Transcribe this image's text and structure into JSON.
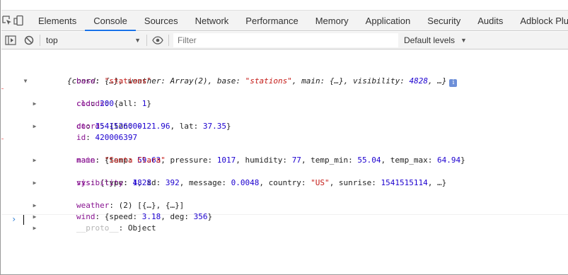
{
  "tabs": [
    "Elements",
    "Console",
    "Sources",
    "Network",
    "Performance",
    "Memory",
    "Application",
    "Security",
    "Audits",
    "Adblock Plus"
  ],
  "active_tab": "Console",
  "toolbar": {
    "context": "top",
    "filter_placeholder": "Filter",
    "levels": "Default levels"
  },
  "summary": {
    "open": "{coord: {…}, weather: Array(2), base: ",
    "base_val": "\"stations\"",
    "mid": ", main: {…}, visibility: ",
    "vis_val": "4828",
    "tail": ", …}",
    "info": "i"
  },
  "props": {
    "base": {
      "key": "base",
      "value": "\"stations\""
    },
    "clouds": {
      "key": "clouds",
      "pre": "{all: ",
      "num": "1",
      "post": "}"
    },
    "cod": {
      "key": "cod",
      "value": "200"
    },
    "coord": {
      "key": "coord",
      "pre": "{lon: ",
      "lon": "-121.96",
      "mid": ", lat: ",
      "lat": "37.35",
      "post": "}"
    },
    "dt": {
      "key": "dt",
      "value": "1541526000"
    },
    "id": {
      "key": "id",
      "value": "420006397"
    },
    "main": {
      "key": "main",
      "p1": "{temp: ",
      "temp": "59.63",
      "p2": ", pressure: ",
      "pressure": "1017",
      "p3": ", humidity: ",
      "humidity": "77",
      "p4": ", temp_min: ",
      "temp_min": "55.04",
      "p5": ", temp_max: ",
      "temp_max": "64.94",
      "p6": "}"
    },
    "name": {
      "key": "name",
      "value": "\"Santa Clara\""
    },
    "sys": {
      "key": "sys",
      "p1": "{type: ",
      "type": "1",
      "p2": ", id: ",
      "id": "392",
      "p3": ", message: ",
      "message": "0.0048",
      "p4": ", country: ",
      "country": "\"US\"",
      "p5": ", sunrise: ",
      "sunrise": "1541515114",
      "p6": ", …}"
    },
    "visibility": {
      "key": "visibility",
      "value": "4828"
    },
    "weather": {
      "key": "weather",
      "value": "(2) [{…}, {…}]"
    },
    "wind": {
      "key": "wind",
      "p1": "{speed: ",
      "speed": "3.18",
      "p2": ", deg: ",
      "deg": "356",
      "p3": "}"
    },
    "proto": {
      "key": "__proto__",
      "value": "Object"
    }
  }
}
